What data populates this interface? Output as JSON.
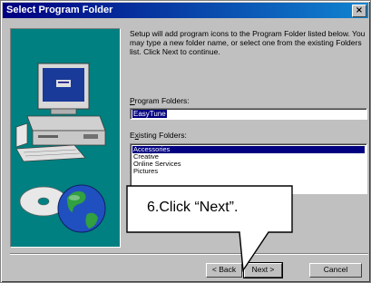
{
  "window": {
    "title": "Select Program Folder",
    "close_glyph": "×"
  },
  "content": {
    "description": "Setup will add program icons to the Program Folder listed below. You may type a new folder name, or select one from the existing Folders list. Click Next to continue.",
    "program_folder_label_first": "P",
    "program_folder_label_rest": "rogram Folders:",
    "program_folder_value": "EasyTune",
    "existing_folders_label_first": "x",
    "existing_folders_label_pre": "E",
    "existing_folders_label_rest": "isting Folders:",
    "existing_folders": [
      "Accessories",
      "Creative",
      "Online Services",
      "Pictures"
    ],
    "selected_index": 0
  },
  "buttons": {
    "back_label": "< Back",
    "next_label": "Next >",
    "cancel_label": "Cancel"
  },
  "callout": {
    "text": "6.Click “Next”."
  },
  "icons": {
    "illustration": "computer-and-globe-illustration",
    "close": "close-icon"
  },
  "colors": {
    "dialog_face": "#c0c0c0",
    "title_bar": "#000080",
    "art_background": "#008080",
    "selection": "#000080"
  }
}
